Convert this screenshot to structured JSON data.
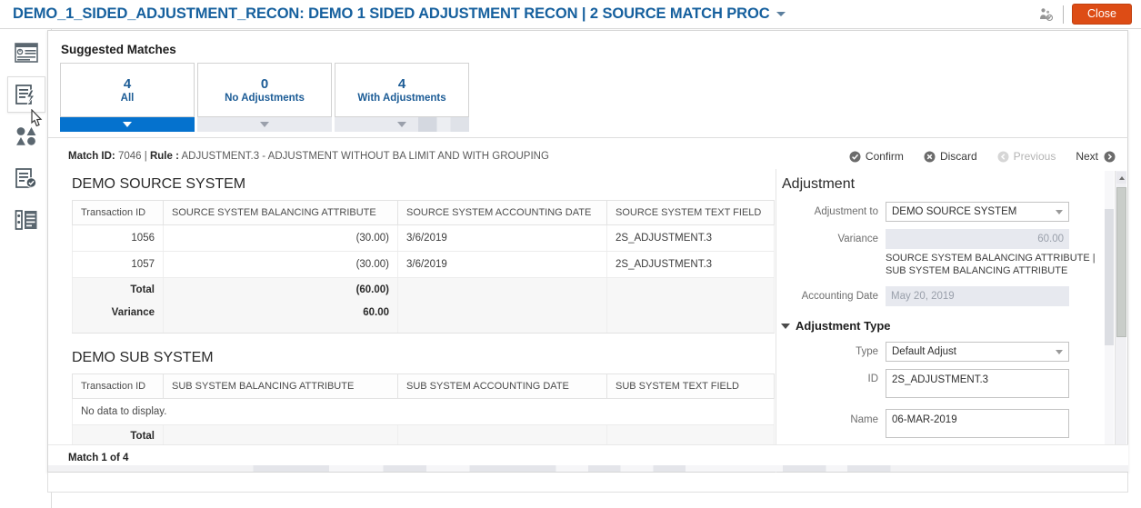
{
  "header": {
    "title": "DEMO_1_SIDED_ADJUSTMENT_RECON: DEMO 1 SIDED ADJUSTMENT RECON | 2 SOURCE MATCH PROC",
    "caret_icon": "chevron-down-icon",
    "people_icon": "people-icon",
    "close_label": "Close"
  },
  "sidebar": {
    "items": [
      {
        "icon": "dashboard-icon",
        "name": "sidebar-item-dashboard"
      },
      {
        "icon": "auto-match-icon",
        "name": "sidebar-item-auto-match"
      },
      {
        "icon": "shapes-match-icon",
        "name": "sidebar-item-shapes"
      },
      {
        "icon": "checklist-icon",
        "name": "sidebar-item-checklist"
      },
      {
        "icon": "list-detail-icon",
        "name": "sidebar-item-list-detail"
      }
    ]
  },
  "suggested": {
    "title": "Suggested Matches",
    "cards": [
      {
        "count": "4",
        "label": "All",
        "selected": true
      },
      {
        "count": "0",
        "label": "No Adjustments",
        "selected": false
      },
      {
        "count": "4",
        "label": "With Adjustments",
        "selected": false
      }
    ]
  },
  "match_bar": {
    "match_id_label": "Match ID:",
    "match_id": "7046",
    "separator": "|",
    "rule_label": "Rule :",
    "rule_value": "ADJUSTMENT.3 - ADJUSTMENT WITHOUT BA LIMIT AND WITH GROUPING",
    "actions": [
      {
        "label": "Confirm",
        "icon": "check-circle-icon",
        "disabled": false
      },
      {
        "label": "Discard",
        "icon": "x-circle-icon",
        "disabled": false
      },
      {
        "label": "Previous",
        "icon": "left-circle-icon",
        "disabled": true
      },
      {
        "label": "Next",
        "icon": "right-circle-icon",
        "disabled": false
      }
    ]
  },
  "source_table": {
    "title": "DEMO SOURCE SYSTEM",
    "columns": [
      "Transaction ID",
      "SOURCE SYSTEM BALANCING ATTRIBUTE",
      "SOURCE SYSTEM ACCOUNTING DATE",
      "SOURCE SYSTEM TEXT FIELD"
    ],
    "rows": [
      {
        "txn": "1056",
        "bal": "(30.00)",
        "date": "3/6/2019",
        "text": "2S_ADJUSTMENT.3"
      },
      {
        "txn": "1057",
        "bal": "(30.00)",
        "date": "3/6/2019",
        "text": "2S_ADJUSTMENT.3"
      }
    ],
    "total_label": "Total",
    "total_value": "(60.00)",
    "variance_label": "Variance",
    "variance_value": "60.00"
  },
  "sub_table": {
    "title": "DEMO SUB SYSTEM",
    "columns": [
      "Transaction ID",
      "SUB SYSTEM BALANCING ATTRIBUTE",
      "SUB SYSTEM ACCOUNTING DATE",
      "SUB SYSTEM TEXT FIELD"
    ],
    "no_data": "No data to display.",
    "total_label": "Total"
  },
  "adjustment": {
    "title": "Adjustment",
    "adjustment_to_label": "Adjustment to",
    "adjustment_to_value": "DEMO SOURCE SYSTEM",
    "variance_label": "Variance",
    "variance_value": "60.00",
    "helper_text": "SOURCE SYSTEM BALANCING ATTRIBUTE | SUB SYSTEM BALANCING ATTRIBUTE",
    "accounting_date_label": "Accounting Date",
    "accounting_date_value": "May 20, 2019",
    "type_section_title": "Adjustment Type",
    "type_label": "Type",
    "type_value": "Default Adjust",
    "id_label": "ID",
    "id_value": "2S_ADJUSTMENT.3",
    "name_label": "Name",
    "name_value": "06-MAR-2019"
  },
  "footer": {
    "match_of": "Match 1 of 4"
  },
  "colors": {
    "accent_blue": "#0572ce",
    "title_blue": "#16609e",
    "close_orange": "#dd4c15",
    "card_text_blue": "#1c5c96"
  }
}
